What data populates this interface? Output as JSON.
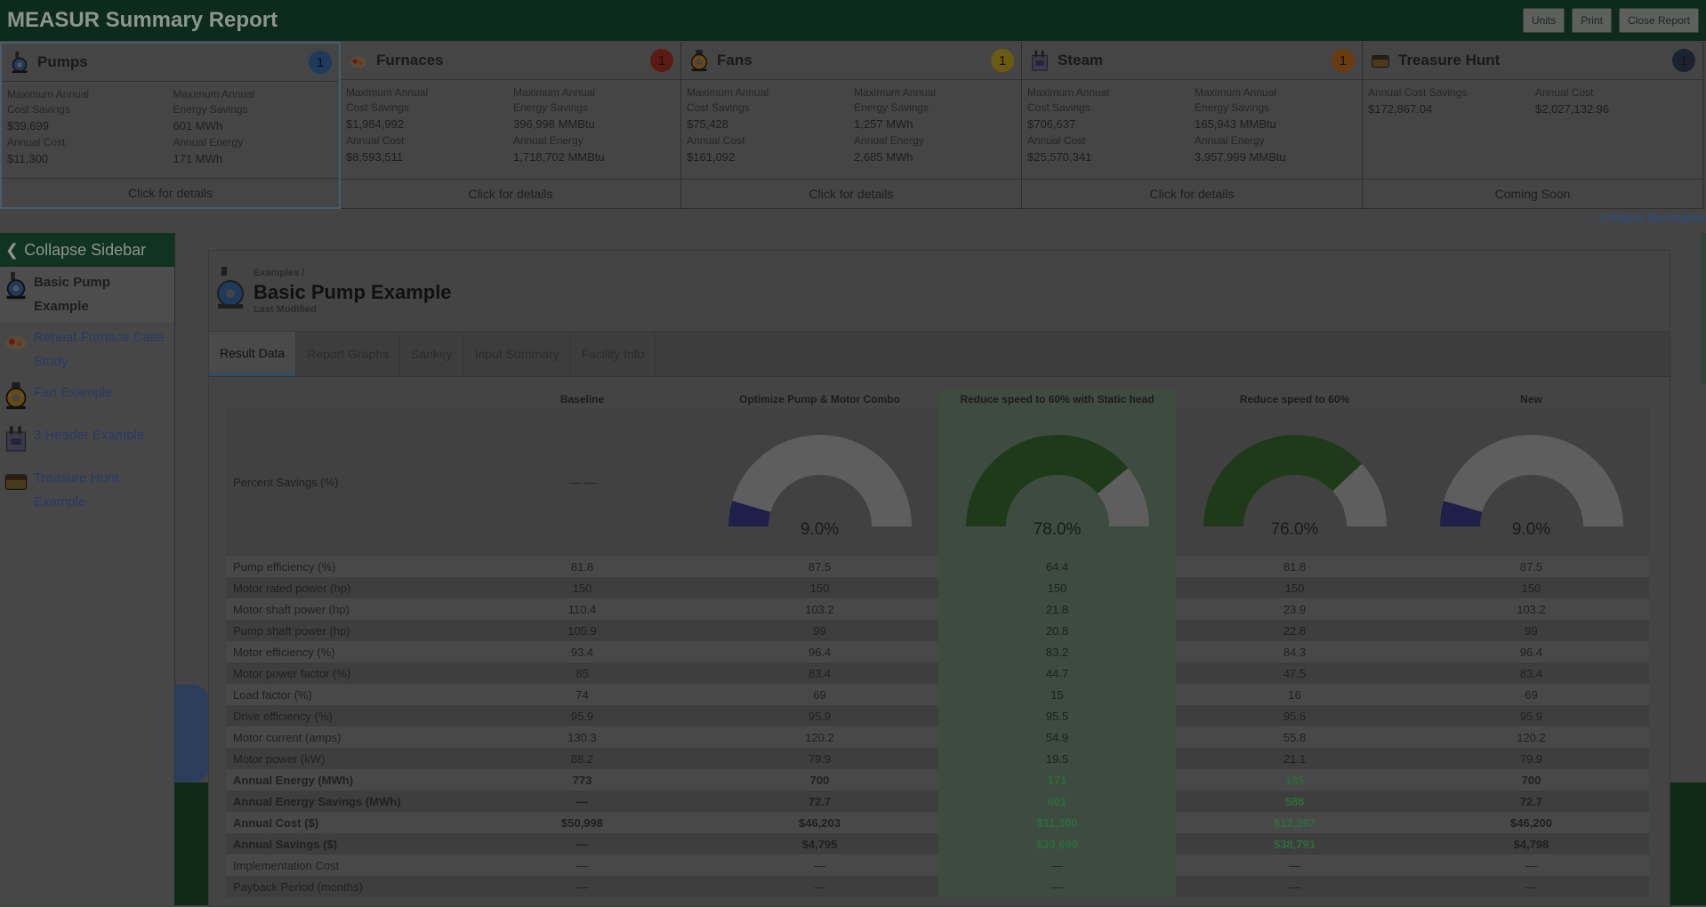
{
  "topbar": {
    "title": "MEASUR Summary Report",
    "buttons": [
      "Units",
      "Print",
      "Close Report"
    ]
  },
  "summaries": [
    {
      "name": "Pumps",
      "badge": "1",
      "badge_color": "#1e3a5c",
      "icon": "pump-icon",
      "l1a": "Maximum Annual",
      "l1b": "Cost Savings",
      "v1": "$39,699",
      "l2a": "Maximum Annual",
      "l2b": "Energy Savings",
      "v2": "601 MWh",
      "l3": "Annual Cost",
      "v3": "$11,300",
      "l4": "Annual Energy",
      "v4": "171 MWh",
      "footer": "Click for details"
    },
    {
      "name": "Furnaces",
      "badge": "1",
      "badge_color": "#5c1a12",
      "icon": "furnace-icon",
      "l1a": "Maximum Annual",
      "l1b": "Cost Savings",
      "v1": "$1,984,992",
      "l2a": "Maximum Annual",
      "l2b": "Energy Savings",
      "v2": "396,998 MMBtu",
      "l3": "Annual Cost",
      "v3": "$8,593,511",
      "l4": "Annual Energy",
      "v4": "1,718,702 MMBtu",
      "footer": "Click for details"
    },
    {
      "name": "Fans",
      "badge": "1",
      "badge_color": "#6a5a12",
      "icon": "fan-icon",
      "l1a": "Maximum Annual",
      "l1b": "Cost Savings",
      "v1": "$75,428",
      "l2a": "Maximum Annual",
      "l2b": "Energy Savings",
      "v2": "1,257 MWh",
      "l3": "Annual Cost",
      "v3": "$161,092",
      "l4": "Annual Energy",
      "v4": "2,685 MWh",
      "footer": "Click for details"
    },
    {
      "name": "Steam",
      "badge": "1",
      "badge_color": "#6a3a10",
      "icon": "steam-icon",
      "l1a": "Maximum Annual",
      "l1b": "Cost Savings",
      "v1": "$706,637",
      "l2a": "Maximum Annual",
      "l2b": "Energy Savings",
      "v2": "165,943 MMBtu",
      "l3": "Annual Cost",
      "v3": "$25,570,341",
      "l4": "Annual Energy",
      "v4": "3,957,999 MMBtu",
      "footer": "Click for details"
    },
    {
      "name": "Treasure Hunt",
      "badge": "1",
      "badge_color": "#1c2230",
      "icon": "treasure-chest-icon",
      "l1a": "Annual Cost Savings",
      "l1b": "",
      "v1": "$172,867.04",
      "l2a": "Annual Cost",
      "l2b": "",
      "v2": "$2,027,132.96",
      "l3": "",
      "v3": "",
      "l4": "",
      "v4": "",
      "footer": "Coming Soon"
    }
  ],
  "collapse_summaries": "- Collapse Summaries",
  "sidebar": {
    "header": "Collapse Sidebar",
    "items": [
      {
        "line1": "Basic Pump",
        "line2": "Example",
        "icon": "pump-icon"
      },
      {
        "line1": "Reheat Furnace Case",
        "line2": "Study",
        "icon": "furnace-icon"
      },
      {
        "line1": "Fan Example",
        "line2": "",
        "icon": "fan-icon"
      },
      {
        "line1": "3 Header Example",
        "line2": "",
        "icon": "steam-icon"
      },
      {
        "line1": "Treasure Hunt",
        "line2": "Example",
        "icon": "treasure-chest-icon"
      }
    ]
  },
  "panel": {
    "breadcrumb": "Examples /",
    "title": "Basic Pump Example",
    "modified": "Last Modified",
    "tabs": [
      "Result Data",
      "Report Graphs",
      "Sankey",
      "Input Summary",
      "Facility Info"
    ]
  },
  "table": {
    "columns": [
      "",
      "Baseline",
      "Optimize Pump & Motor Combo",
      "Reduce speed to 60% with Static head",
      "Reduce speed to 60%",
      "New"
    ],
    "gauge_label": "Percent Savings (%)",
    "baseline_gauge_text": "— —",
    "gauges": [
      {
        "value": 9.0,
        "label": "9.0%",
        "color": "#1f1f4a"
      },
      {
        "value": 78.0,
        "label": "78.0%",
        "color": "#1e3a18"
      },
      {
        "value": 76.0,
        "label": "76.0%",
        "color": "#1e3a18"
      },
      {
        "value": 9.0,
        "label": "9.0%",
        "color": "#1f1f4a"
      }
    ],
    "rows": [
      {
        "label": "Pump efficiency (%)",
        "vals": [
          "81.8",
          "87.5",
          "64.4",
          "81.8",
          "87.5"
        ]
      },
      {
        "label": "Motor rated power (hp)",
        "vals": [
          "150",
          "150",
          "150",
          "150",
          "150"
        ]
      },
      {
        "label": "Motor shaft power (hp)",
        "vals": [
          "110.4",
          "103.2",
          "21.8",
          "23.9",
          "103.2"
        ]
      },
      {
        "label": "Pump shaft power (hp)",
        "vals": [
          "105.9",
          "99",
          "20.8",
          "22.8",
          "99"
        ]
      },
      {
        "label": "Motor efficiency (%)",
        "vals": [
          "93.4",
          "96.4",
          "83.2",
          "84.3",
          "96.4"
        ]
      },
      {
        "label": "Motor power factor (%)",
        "vals": [
          "85",
          "83.4",
          "44.7",
          "47.5",
          "83.4"
        ]
      },
      {
        "label": "Load factor (%)",
        "vals": [
          "74",
          "69",
          "15",
          "16",
          "69"
        ]
      },
      {
        "label": "Drive efficiency (%)",
        "vals": [
          "95.9",
          "95.9",
          "95.5",
          "95.6",
          "95.9"
        ]
      },
      {
        "label": "Motor current (amps)",
        "vals": [
          "130.3",
          "120.2",
          "54.9",
          "55.8",
          "120.2"
        ]
      },
      {
        "label": "Motor power (kW)",
        "vals": [
          "88.2",
          "79.9",
          "19.5",
          "21.1",
          "79.9"
        ]
      },
      {
        "label": "Annual Energy (MWh)",
        "vals": [
          "773",
          "700",
          "171",
          "185",
          "700"
        ],
        "bold": true,
        "green": [
          2,
          3
        ]
      },
      {
        "label": "Annual Energy Savings (MWh)",
        "vals": [
          "—",
          "72.7",
          "601",
          "588",
          "72.7"
        ],
        "bold": true,
        "green": [
          2,
          3
        ]
      },
      {
        "label": "Annual Cost ($)",
        "vals": [
          "$50,998",
          "$46,203",
          "$11,300",
          "$12,207",
          "$46,200"
        ],
        "bold": true,
        "green": [
          2,
          3
        ]
      },
      {
        "label": "Annual Savings ($)",
        "vals": [
          "—",
          "$4,795",
          "$39,699",
          "$38,791",
          "$4,798"
        ],
        "bold": true,
        "green": [
          2,
          3
        ]
      },
      {
        "label": "Implementation Cost",
        "vals": [
          "—",
          "—",
          "—",
          "—",
          "—"
        ]
      },
      {
        "label": "Payback Period (months)",
        "vals": [
          "—",
          "—",
          "—",
          "—",
          "—"
        ]
      }
    ]
  }
}
